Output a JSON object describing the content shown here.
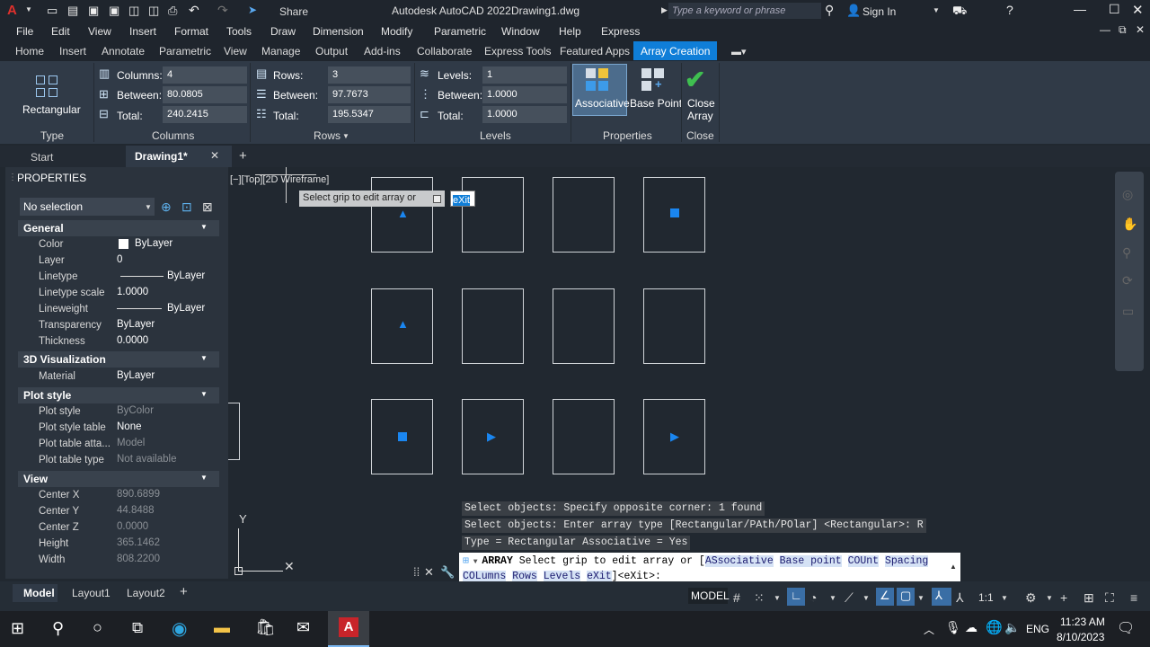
{
  "app_title": "Autodesk AutoCAD 2022",
  "doc_title": "Drawing1.dwg",
  "share_label": "Share",
  "search_placeholder": "Type a keyword or phrase",
  "sign_in": "Sign In",
  "menu": [
    "File",
    "Edit",
    "View",
    "Insert",
    "Format",
    "Tools",
    "Draw",
    "Dimension",
    "Modify",
    "Parametric",
    "Window",
    "Help",
    "Express"
  ],
  "ribbon_tabs": [
    "Home",
    "Insert",
    "Annotate",
    "Parametric",
    "View",
    "Manage",
    "Output",
    "Add-ins",
    "Collaborate",
    "Express Tools",
    "Featured Apps",
    "Array Creation"
  ],
  "ribbon": {
    "type_label": "Rectangular",
    "type_panel": "Type",
    "columns": {
      "label": "Columns:",
      "value": "4",
      "between_label": "Between:",
      "between": "80.0805",
      "total_label": "Total:",
      "total": "240.2415",
      "panel": "Columns"
    },
    "rows": {
      "label": "Rows:",
      "value": "3",
      "between_label": "Between:",
      "between": "97.7673",
      "total_label": "Total:",
      "total": "195.5347",
      "panel": "Rows"
    },
    "levels": {
      "label": "Levels:",
      "value": "1",
      "between_label": "Between:",
      "between": "1.0000",
      "total_label": "Total:",
      "total": "1.0000",
      "panel": "Levels"
    },
    "associative": "Associative",
    "base_point": "Base Point",
    "properties_panel": "Properties",
    "close_line1": "Close",
    "close_line2": "Array",
    "close_panel": "Close"
  },
  "doc_tabs": {
    "start": "Start",
    "drawing": "Drawing1*"
  },
  "properties": {
    "title": "PROPERTIES",
    "selection": "No selection",
    "general": "General",
    "color_label": "Color",
    "color": "ByLayer",
    "layer_label": "Layer",
    "layer": "0",
    "linetype_label": "Linetype",
    "linetype": "ByLayer",
    "ltscale_label": "Linetype scale",
    "ltscale": "1.0000",
    "lineweight_label": "Lineweight",
    "lineweight": "ByLayer",
    "transparency_label": "Transparency",
    "transparency": "ByLayer",
    "thickness_label": "Thickness",
    "thickness": "0.0000",
    "viz3d": "3D Visualization",
    "material_label": "Material",
    "material": "ByLayer",
    "plot_style": "Plot style",
    "ps_label": "Plot style",
    "ps": "ByColor",
    "pst_label": "Plot style table",
    "pst": "None",
    "pta_label": "Plot table atta...",
    "pta": "Model",
    "ptt_label": "Plot table type",
    "ptt": "Not available",
    "view": "View",
    "cx_label": "Center X",
    "cx": "890.6899",
    "cy_label": "Center Y",
    "cy": "44.8488",
    "cz_label": "Center Z",
    "cz": "0.0000",
    "h_label": "Height",
    "h": "365.1462",
    "w_label": "Width",
    "w": "808.2200"
  },
  "viewport_label": "[−][Top][2D Wireframe]",
  "tooltip": {
    "text": "Select grip to edit array or",
    "option": "eXit"
  },
  "history": [
    "Select objects: Specify opposite corner: 1 found",
    "Select objects:  Enter array type [Rectangular/PAth/POlar] <Rectangular>: R",
    "Type = Rectangular  Associative = Yes"
  ],
  "command": {
    "cmd": "ARRAY",
    "prompt": "Select grip to edit array or [",
    "opts1": [
      "ASsociative",
      "Base point",
      "COUnt",
      "Spacing"
    ],
    "opts2": [
      "COLumns",
      "Rows",
      "Levels",
      "eXit"
    ],
    "tail": "]<eXit>:"
  },
  "layout_tabs": [
    "Model",
    "Layout1",
    "Layout2"
  ],
  "status": {
    "model": "MODEL",
    "scale": "1:1"
  },
  "clock": {
    "time": "11:23 AM",
    "date": "8/10/2023"
  },
  "lang": "ENG",
  "accent": "#0f7ed8"
}
